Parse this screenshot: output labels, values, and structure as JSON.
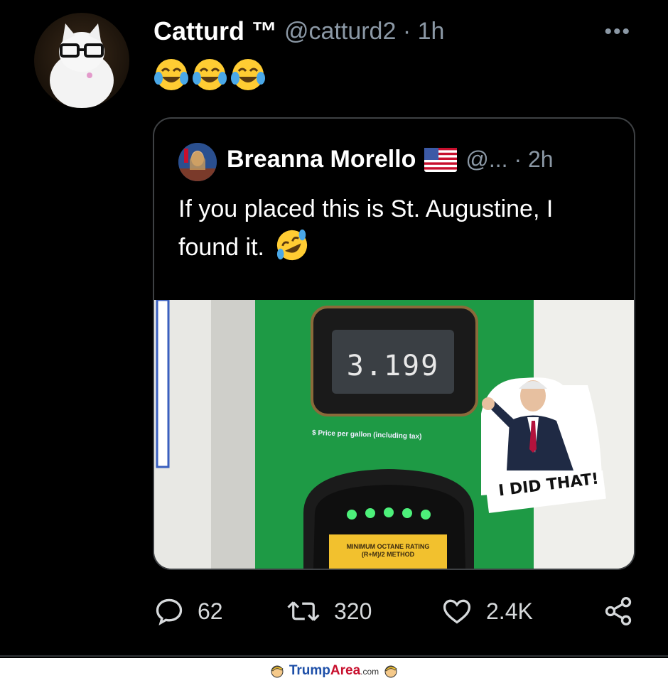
{
  "tweet": {
    "author_name": "Catturd ™",
    "handle_time": "@catturd2 · 1h",
    "more_label": "•••",
    "emojis": [
      "face-with-tears-of-joy",
      "face-with-tears-of-joy",
      "face-with-tears-of-joy"
    ]
  },
  "quote": {
    "author_name": "Breanna Morello",
    "flag": "us-flag",
    "handle_time": "@... · 2h",
    "text": "If you placed this is St. Augustine, I found it.",
    "text_emoji": "rolling-on-the-floor-laughing",
    "image": {
      "price_display": "3.199",
      "price_caption": "$ Price per gallon (including tax)",
      "sticker_text": "I DID THAT!",
      "rating_label_1": "MINIMUM OCTANE RATING",
      "rating_label_2": "(R+M)/2 METHOD"
    }
  },
  "actions": {
    "reply_count": "62",
    "retweet_count": "320",
    "like_count": "2.4K"
  },
  "footer": {
    "brand_part1": "Trump",
    "brand_part2": "Area",
    "brand_suffix": ".com"
  },
  "colors": {
    "background": "#000000",
    "secondary_text": "#8b98a5",
    "pump_green": "#1e9a45",
    "brand_blue": "#1d4fa8",
    "brand_red": "#c8102e"
  }
}
